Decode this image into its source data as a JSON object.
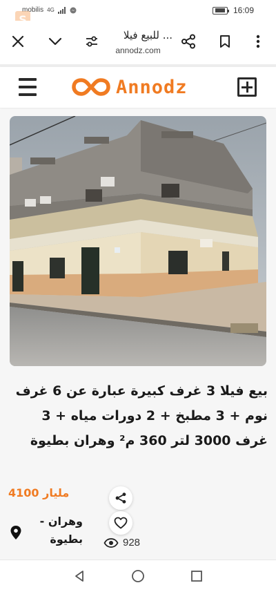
{
  "status_bar": {
    "carrier": "mobilis",
    "network": "4G",
    "time": "16:09"
  },
  "browser": {
    "page_title": "للبيع فيلا ...",
    "url": "annodz.com"
  },
  "site": {
    "logo_text": "Annodz",
    "accent_color": "#f07b22"
  },
  "listing": {
    "title": "بيع فيلا 3 غرف كبيرة عبارة عن 6 غرف نوم + 3 مطبخ + 2 دورات مياه + 3 غرف 3000 لتر 360 م² وهران بطيوة",
    "price": "4100 مليار",
    "location": "وهران - بطيوة",
    "views": "928"
  },
  "icons": {
    "close": "close-icon",
    "chevron": "chevron-down-icon",
    "filter": "filter-icon",
    "share": "share-icon",
    "bookmark": "bookmark-icon",
    "more": "more-vertical-icon",
    "menu": "hamburger-icon",
    "add": "add-square-icon",
    "heart": "heart-icon",
    "eye": "eye-icon",
    "pin": "map-pin-icon"
  }
}
